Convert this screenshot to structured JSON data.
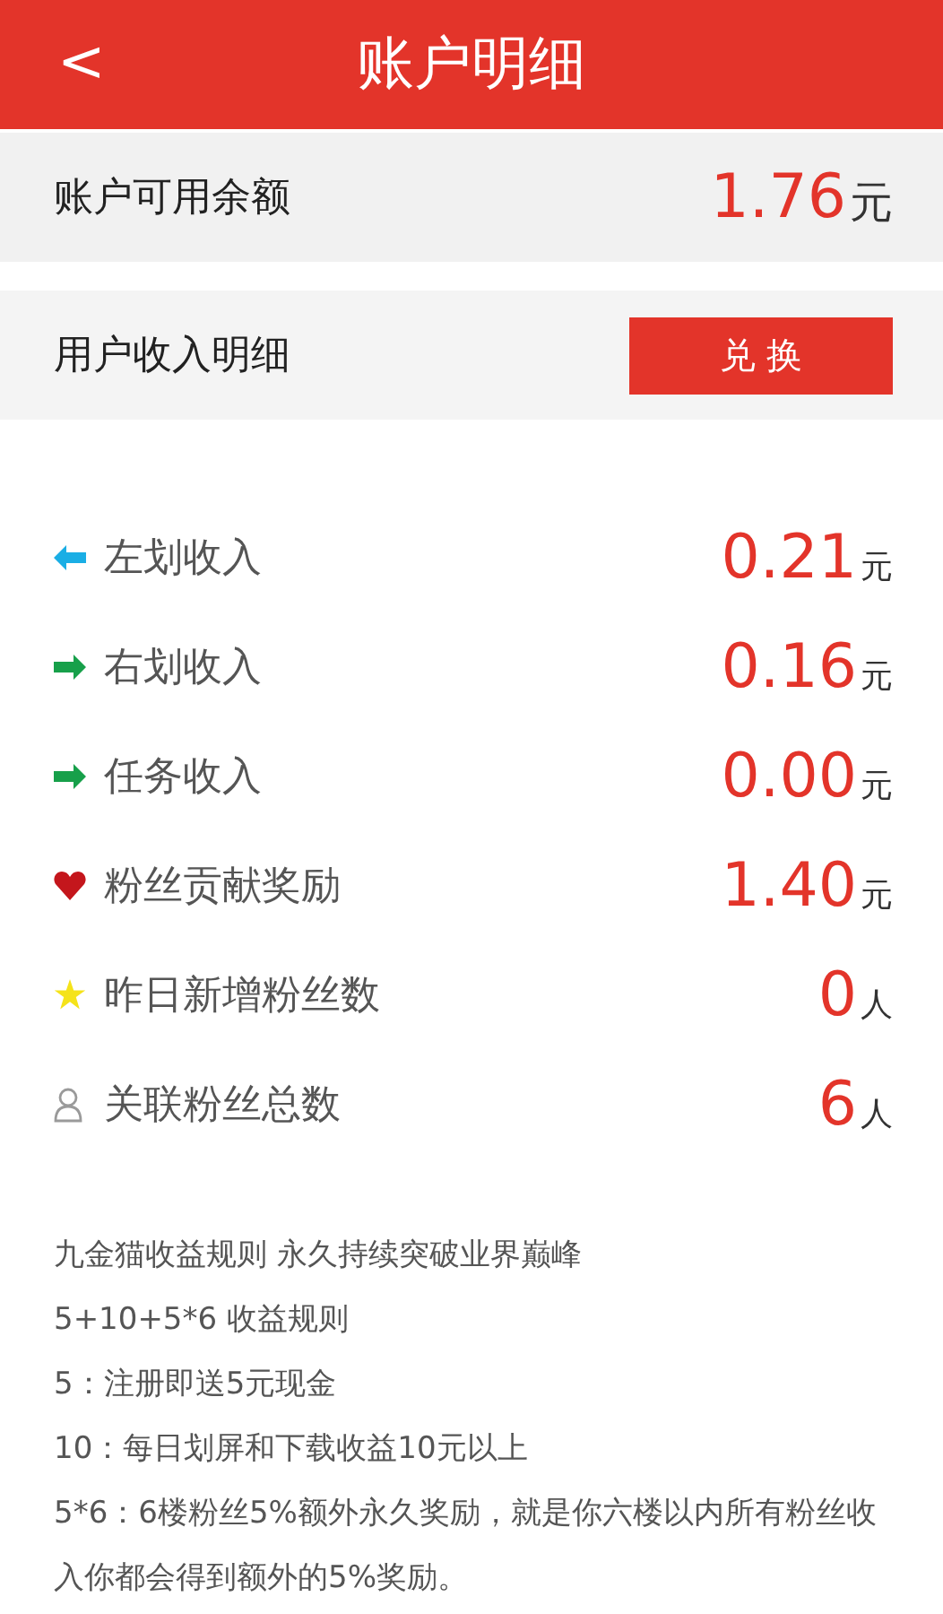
{
  "header": {
    "back": "<",
    "title": "账户明细"
  },
  "balance": {
    "label": "账户可用余额",
    "amount": "1.76",
    "unit": "元"
  },
  "income_header": {
    "label": "用户收入明细",
    "button": "兑 换"
  },
  "items": [
    {
      "kind": "left",
      "color": "#1aaee5",
      "label": "左划收入",
      "amount": "0.21",
      "unit": "元"
    },
    {
      "kind": "right",
      "color": "#17a04a",
      "label": "右划收入",
      "amount": "0.16",
      "unit": "元"
    },
    {
      "kind": "right",
      "color": "#17a04a",
      "label": "任务收入",
      "amount": "0.00",
      "unit": "元"
    },
    {
      "kind": "heart",
      "color": "#c4161c",
      "label": "粉丝贡献奖励",
      "amount": "1.40",
      "unit": "元"
    },
    {
      "kind": "star",
      "color": "#f5e31a",
      "label": "昨日新增粉丝数",
      "amount": "0",
      "unit": "人"
    },
    {
      "kind": "person",
      "color": "#9a9a9a",
      "label": "关联粉丝总数",
      "amount": "6",
      "unit": "人"
    }
  ],
  "rules": [
    "九金猫收益规则  永久持续突破业界巅峰",
    "5+10+5*6 收益规则",
    "5：注册即送5元现金",
    "10：每日划屏和下载收益10元以上",
    "5*6：6楼粉丝5%额外永久奖励，就是你六楼以内所有粉丝收入你都会得到额外的5%奖励。"
  ]
}
